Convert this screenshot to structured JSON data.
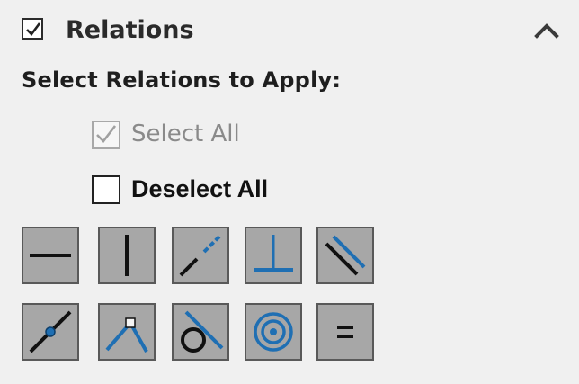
{
  "section": {
    "title": "Relations",
    "enabled": true,
    "collapse_icon": "chevron-up-icon"
  },
  "subtitle": "Select Relations to Apply:",
  "options": {
    "select_all": {
      "label": "Select All",
      "checked": true,
      "disabled": true
    },
    "deselect_all": {
      "label": "Deselect All",
      "checked": false,
      "disabled": false
    }
  },
  "relations": [
    {
      "id": "horizontal",
      "icon": "horizontal-relation-icon"
    },
    {
      "id": "vertical",
      "icon": "vertical-relation-icon"
    },
    {
      "id": "collinear",
      "icon": "collinear-relation-icon"
    },
    {
      "id": "perpendicular",
      "icon": "perpendicular-relation-icon"
    },
    {
      "id": "parallel",
      "icon": "parallel-relation-icon"
    },
    {
      "id": "midpoint",
      "icon": "midpoint-relation-icon"
    },
    {
      "id": "coincident",
      "icon": "coincident-relation-icon"
    },
    {
      "id": "tangent",
      "icon": "tangent-relation-icon"
    },
    {
      "id": "concentric",
      "icon": "concentric-relation-icon"
    },
    {
      "id": "equal",
      "icon": "equal-relation-icon"
    }
  ],
  "colors": {
    "panel_bg": "#f0f0f0",
    "button_bg": "#a7a7a7",
    "accent_blue": "#1f6fb3"
  }
}
